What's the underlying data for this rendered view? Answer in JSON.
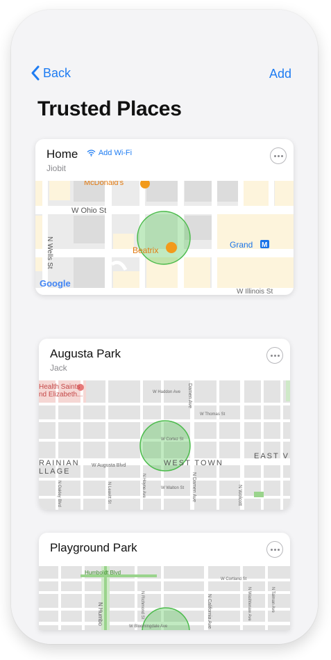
{
  "nav": {
    "back_label": "Back",
    "add_label": "Add"
  },
  "page_title": "Trusted Places",
  "places": [
    {
      "name": "Home",
      "wifi_label": "Add Wi-Fi",
      "owner": "Jiobit",
      "map_labels": {
        "street1": "W Ohio St",
        "street2": "N Wells St",
        "street3": "W Illinois St",
        "poi1": "McDonald's",
        "poi2": "Beatrix",
        "transit": "Grand",
        "brand": "Google"
      }
    },
    {
      "name": "Augusta Park",
      "owner": "Jack",
      "map_labels": {
        "poi": "Health Saints\nnd Elizabeth...",
        "neighborhood1": "WEST TOWN",
        "neighborhood2": "RAINIAN\nLLAGE",
        "neighborhood3": "EAST V",
        "street_augusta": "W Augusta Blvd",
        "street_cortez": "W Cortez St",
        "street_walton": "W Walton St",
        "street_thomas": "W Thomas St",
        "street_haddon": "W Haddon Ave",
        "street_damen": "Damen Ave",
        "street_damen2": "N Damen Ave",
        "street_hoyne": "N Hoyne Ave",
        "street_wolcott": "N Wolcott",
        "street_leavitt": "N Leavitt St",
        "street_oakley": "N Oakley Blvd"
      }
    },
    {
      "name": "Playground Park",
      "map_labels": {
        "street_humboldt": "Humboldt Blvd",
        "street_cortland": "W Cortland St",
        "street_bloomingdale": "W Bloomingdale Ave",
        "street_california": "N California Ave",
        "street_richmond": "N Richmond St",
        "street_humb2": "N Humbo",
        "street_washtenaw": "N Washtenaw Ave",
        "street_talman": "N Talman Ave"
      }
    }
  ]
}
